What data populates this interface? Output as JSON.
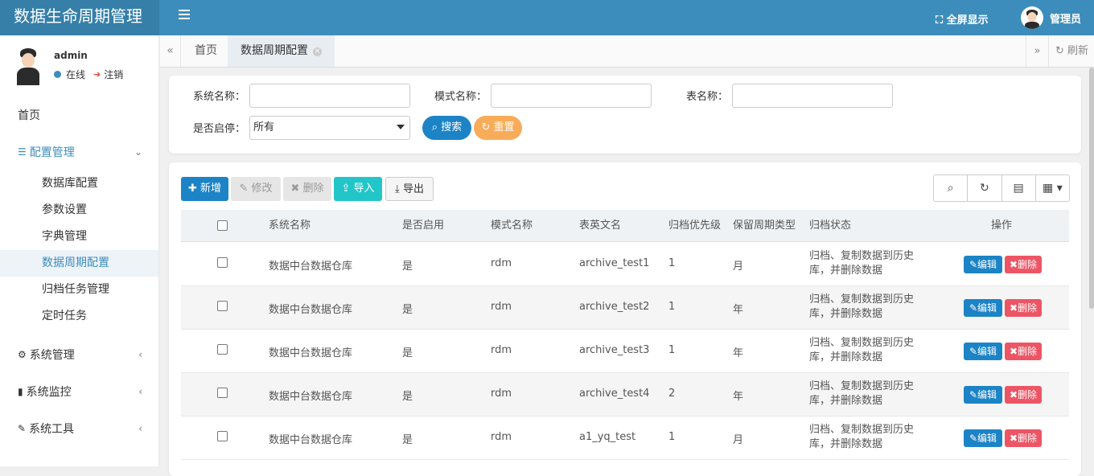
{
  "app": {
    "title": "数据生命周期管理",
    "fullscreen_label": "全屏显示",
    "user_label": "管理员"
  },
  "sidebar": {
    "user": {
      "name": "admin",
      "status": "在线",
      "logout": "注销"
    },
    "menu": [
      {
        "label": "首页"
      },
      {
        "label": "配置管理",
        "children": [
          "数据库配置",
          "参数设置",
          "字典管理",
          "数据周期配置",
          "归档任务管理",
          "定时任务"
        ]
      },
      {
        "label": "系统管理"
      },
      {
        "label": "系统监控"
      },
      {
        "label": "系统工具"
      }
    ]
  },
  "tabs": {
    "items": [
      "首页",
      "数据周期配置"
    ],
    "refresh": "刷新"
  },
  "search": {
    "system_label": "系统名称：",
    "schema_label": "模式名称：",
    "table_label": "表名称：",
    "enabled_label": "是否启停：",
    "enabled_value": "所有",
    "search_btn": "搜索",
    "reset_btn": "重置"
  },
  "toolbar": {
    "add": "新增",
    "edit": "修改",
    "delete": "删除",
    "import": "导入",
    "export": "导出"
  },
  "table": {
    "headers": [
      "系统名称",
      "是否启用",
      "模式名称",
      "表英文名",
      "归档优先级",
      "保留周期类型",
      "归档状态",
      "操作"
    ],
    "rows": [
      {
        "system": "数据中台数据仓库",
        "enabled": "是",
        "schema": "rdm",
        "table": "archive_test1",
        "priority": "1",
        "period": "月",
        "status": "归档、复制数据到历史库，并删除数据"
      },
      {
        "system": "数据中台数据仓库",
        "enabled": "是",
        "schema": "rdm",
        "table": "archive_test2",
        "priority": "1",
        "period": "年",
        "status": "归档、复制数据到历史库，并删除数据"
      },
      {
        "system": "数据中台数据仓库",
        "enabled": "是",
        "schema": "rdm",
        "table": "archive_test3",
        "priority": "1",
        "period": "年",
        "status": "归档、复制数据到历史库，并删除数据"
      },
      {
        "system": "数据中台数据仓库",
        "enabled": "是",
        "schema": "rdm",
        "table": "archive_test4",
        "priority": "2",
        "period": "年",
        "status": "归档、复制数据到历史库，并删除数据"
      },
      {
        "system": "数据中台数据仓库",
        "enabled": "是",
        "schema": "rdm",
        "table": "a1_yq_test",
        "priority": "1",
        "period": "月",
        "status": "归档、复制数据到历史库，并删除数据"
      }
    ],
    "row_edit": "编辑",
    "row_delete": "删除"
  }
}
